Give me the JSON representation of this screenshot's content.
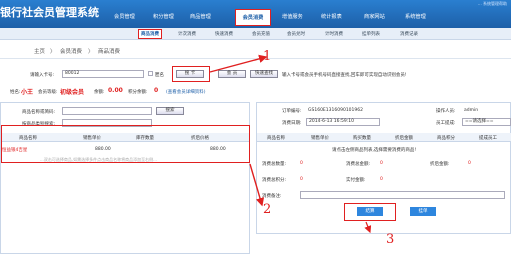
{
  "app": {
    "title": "银行社会员管理系统",
    "top_right": "... 系统管理帮助"
  },
  "nav": [
    "会员管理",
    "积分管理",
    "商品管理",
    "会员消费",
    "增值服务",
    "统计报表",
    "商家网站",
    "系统管理"
  ],
  "subnav": [
    "商品消费",
    "计次消费",
    "快速消费",
    "会员充值",
    "会员兑时",
    "计时消费",
    "挂单列表",
    "消费记录"
  ],
  "breadcrumb": {
    "home": "主页",
    "sep1": "〉",
    "section": "会员消费",
    "sep2": "〉",
    "page": "商品消费"
  },
  "member": {
    "label": "请输入卡号:",
    "value": "80012",
    "chk_label": "匿名",
    "search": "搜 卡",
    "btn2": "会 员",
    "btn3": "快速查找",
    "hint": "输入卡号或会员手机号码直接查找,回车即可实现自动识别会员!"
  },
  "info": {
    "name_label": "姓名:",
    "name": "小王",
    "level_label": "会员等级:",
    "level": "初级会员",
    "balance_label": "余额:",
    "balance": "0.00",
    "points_label": "积分余额:",
    "points": "0",
    "detail": "(查看会员详细资料)"
  },
  "search": {
    "code_label": "商品名称或简码:",
    "search_btn": "搜索",
    "cat_label": "按商品类别搜索:"
  },
  "goods_table": {
    "headers": [
      "商品名称",
      "销售单价",
      "库存数量",
      "折后价格"
    ],
    "rows": [
      [
        "恒益银4吉星",
        "880.00",
        "",
        "880.00"
      ]
    ],
    "note": "...双击可选择商品,如需选择多件点击商品名称将商品添加至右侧..."
  },
  "order": {
    "no_label": "订单编号:",
    "no": "GS160E1316090101962",
    "operator_label": "操作人员:",
    "operator": "admin",
    "time_label": "消费日期:",
    "time": "2014-6-13 16:59:10",
    "staff_label": "员工提成:",
    "staff": "==请选择==",
    "headers": [
      "商品名称",
      "销售单价",
      "购买数量",
      "折后金额",
      "商品积分",
      "提成员工"
    ],
    "empty": "请点击左侧商品列表,选择需要消费的商品!"
  },
  "summary": {
    "qty_label": "消费总数量:",
    "qty": "0",
    "amount_label": "消费总金额:",
    "amount": "0",
    "discount_label": "折后金额:",
    "discount": "0",
    "pts_label": "消费总积分:",
    "pts": "0",
    "pay_label": "实付金额:",
    "pay": "0",
    "remark_label": "消费备注:"
  },
  "actions": {
    "ok": "结算",
    "hang": "挂单"
  },
  "annotations": [
    "1",
    "2",
    "3"
  ],
  "colors": {
    "header": "#1d5fa8",
    "accent": "#e02020",
    "button": "#2e86de"
  }
}
